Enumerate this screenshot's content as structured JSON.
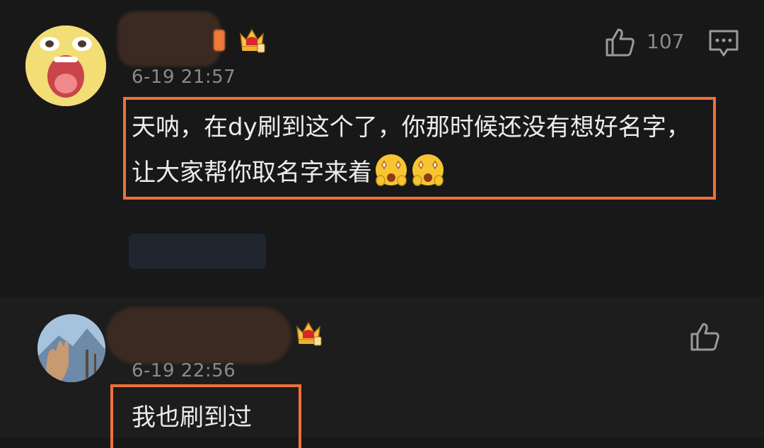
{
  "comments": [
    {
      "time": "6-19 21:57",
      "text": "天呐，在dy刷到这个了，你那时候还没有想好名字，让大家帮你取名字来着",
      "like_count": "107",
      "avatar_icon": "cartoon-face-avatar",
      "badge_icon": "crown-icon",
      "emoji_icon": "starry-eyed-emoji"
    },
    {
      "time": "6-19 22:56",
      "text": "我也刷到过",
      "avatar_icon": "photo-avatar",
      "badge_icon": "crown-icon"
    }
  ],
  "colors": {
    "background": "#181818",
    "highlight_border": "#f0703a",
    "muted_text": "#8a8a8a"
  }
}
